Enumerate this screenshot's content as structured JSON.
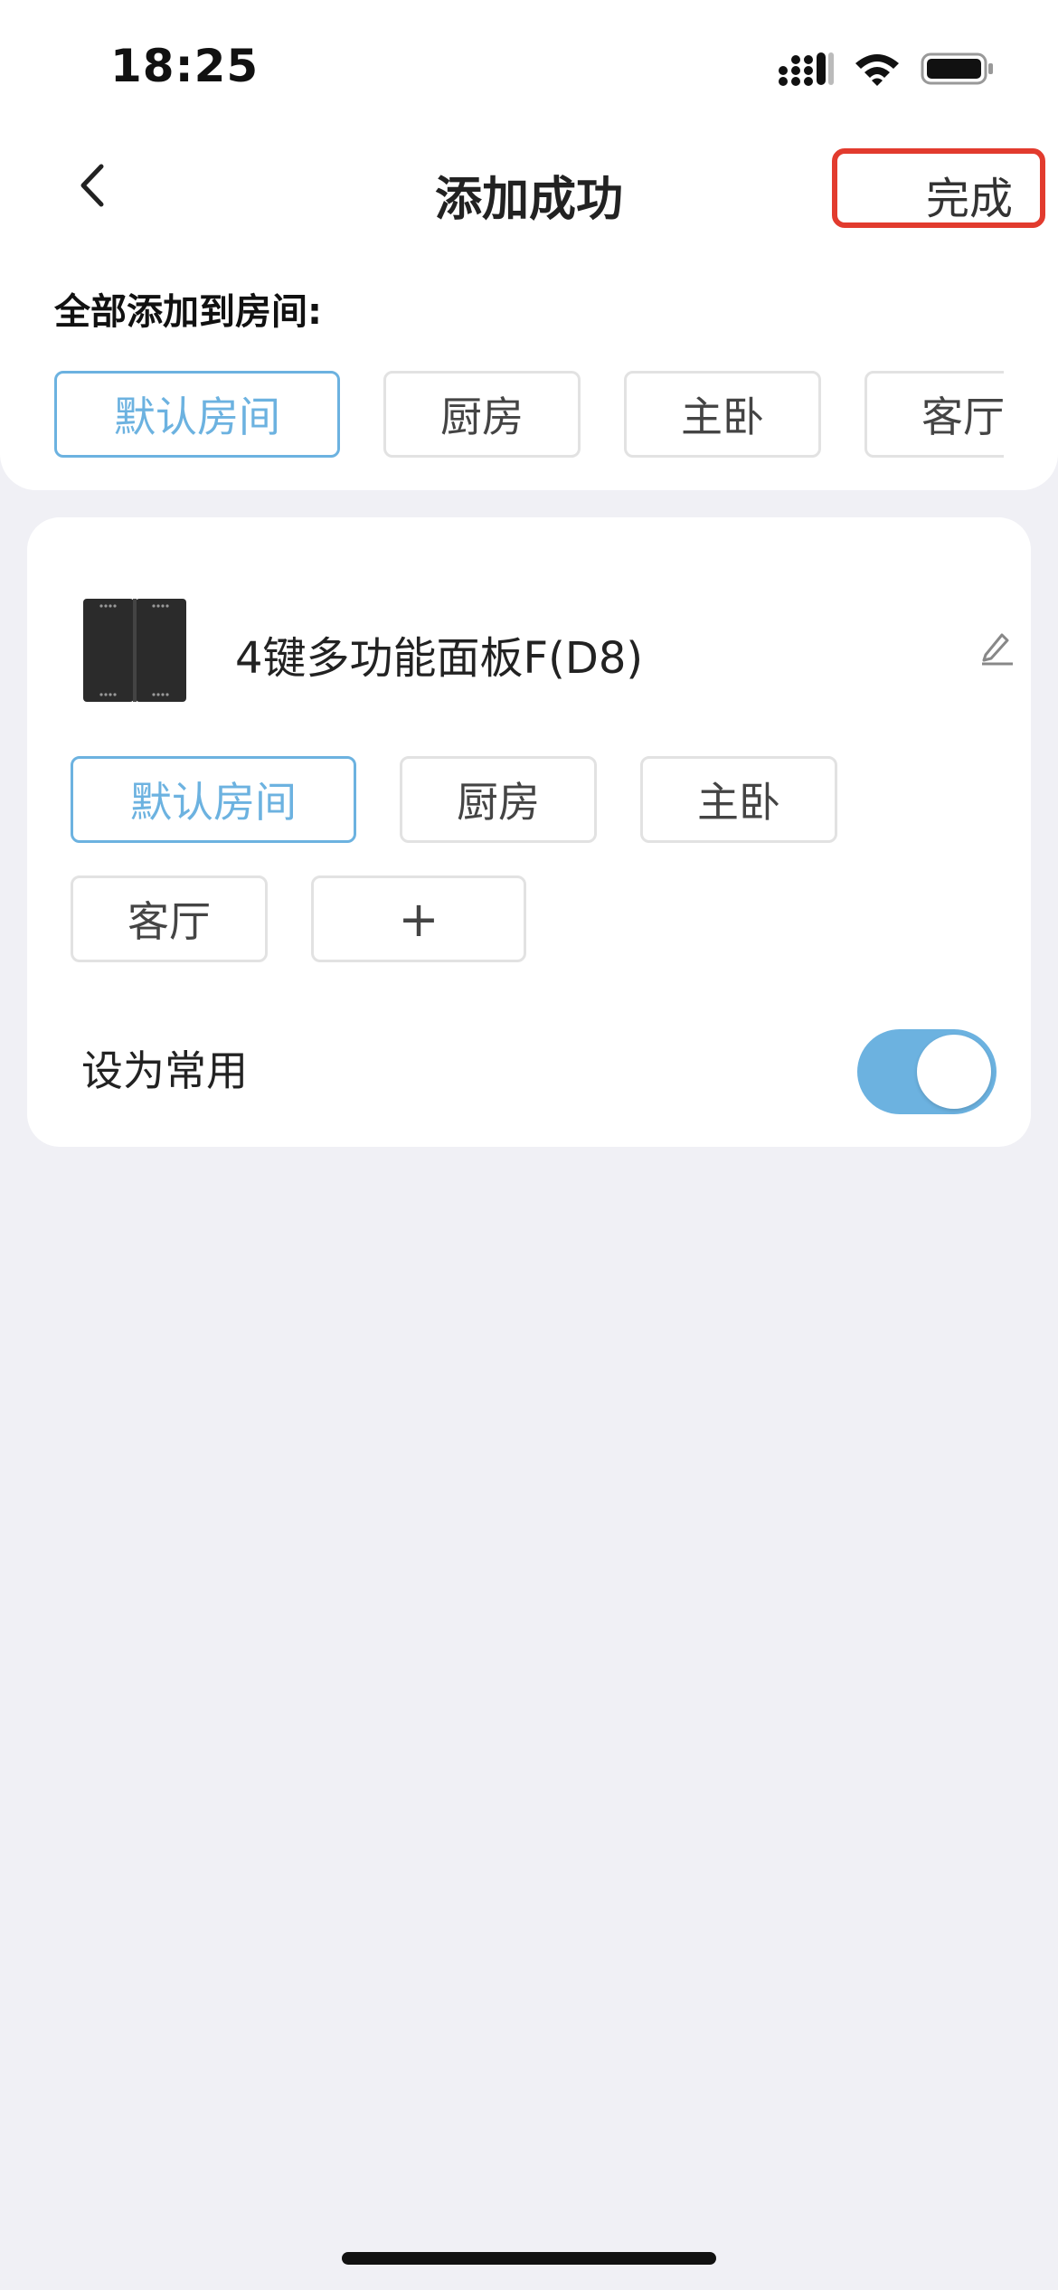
{
  "status_bar": {
    "time": "18:25",
    "icons": [
      "signal-icon",
      "wifi-icon",
      "battery-icon"
    ]
  },
  "header": {
    "back_icon": "chevron-left-icon",
    "title": "添加成功",
    "done_label": "完成"
  },
  "bulk_assign": {
    "label": "全部添加到房间:",
    "rooms": [
      {
        "label": "默认房间",
        "selected": true
      },
      {
        "label": "厨房",
        "selected": false
      },
      {
        "label": "主卧",
        "selected": false
      },
      {
        "label": "客厅",
        "selected": false
      }
    ]
  },
  "device": {
    "name": "4键多功能面板F(D8)",
    "edit_icon": "pencil-icon",
    "rooms": [
      {
        "label": "默认房间",
        "selected": true
      },
      {
        "label": "厨房",
        "selected": false
      },
      {
        "label": "主卧",
        "selected": false
      },
      {
        "label": "客厅",
        "selected": false
      }
    ],
    "add_room_label": "+",
    "favorite_label": "设为常用",
    "favorite_on": true
  },
  "colors": {
    "accent": "#6cb2e0",
    "highlight_border": "#e23b2e",
    "background": "#f0f0f5"
  }
}
